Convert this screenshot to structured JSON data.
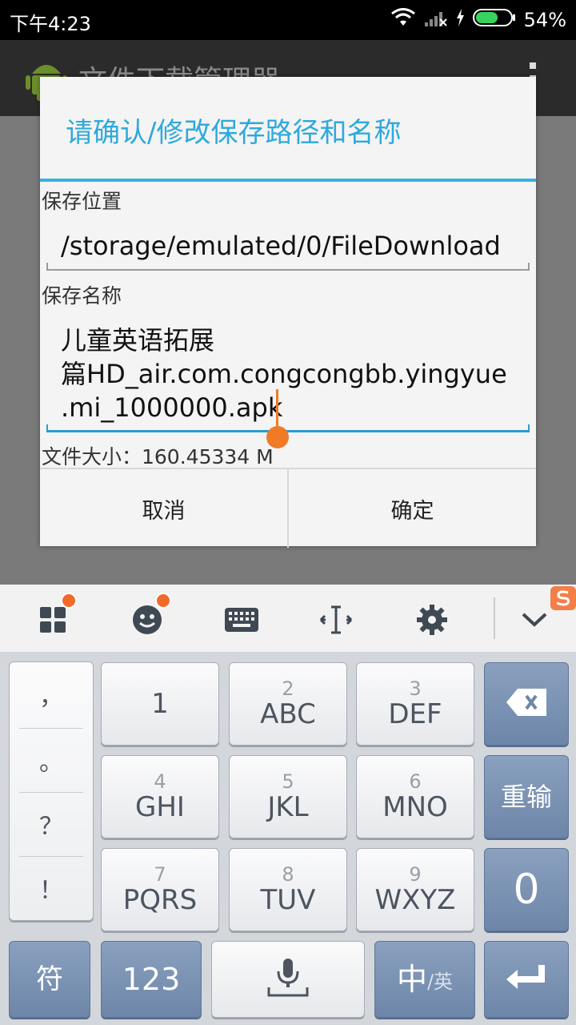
{
  "status_bar": {
    "time": "下午4:23",
    "battery": "54%"
  },
  "app_bar": {
    "title": "文件下载管理器"
  },
  "dialog": {
    "title": "请确认/修改保存路径和名称",
    "save_location_label": "保存位置",
    "save_location_value": "/storage/emulated/0/FileDownload",
    "save_name_label": "保存名称",
    "save_name_line1": "儿童英语拓展",
    "save_name_line2": "篇HD_air.com.congcongbb.yingyue",
    "save_name_line3": ".mi_1000000.apk",
    "file_size": "文件大小：160.45334 M",
    "cancel": "取消",
    "confirm": "确定"
  },
  "ime_toolbar": {
    "icons": [
      "apps-grid-icon",
      "emoji-icon",
      "keyboard-icon",
      "cursor-move-icon",
      "settings-gear-icon",
      "collapse-chevron-icon"
    ]
  },
  "keyboard": {
    "punctuation": [
      "，",
      "。",
      "？",
      "！"
    ],
    "keys": [
      {
        "num": "",
        "letters": "1"
      },
      {
        "num": "2",
        "letters": "ABC"
      },
      {
        "num": "3",
        "letters": "DEF"
      },
      {
        "num": "4",
        "letters": "GHI"
      },
      {
        "num": "5",
        "letters": "JKL"
      },
      {
        "num": "6",
        "letters": "MNO"
      },
      {
        "num": "7",
        "letters": "PQRS"
      },
      {
        "num": "8",
        "letters": "TUV"
      },
      {
        "num": "9",
        "letters": "WXYZ"
      }
    ],
    "reenter": "重输",
    "zero": "0",
    "symbols": "符",
    "numeric": "123",
    "lang_main": "中",
    "lang_sub": "/英"
  },
  "colors": {
    "accent": "#2ea9dc",
    "cursor": "#f07a26",
    "dark_key": "#7a90b1"
  }
}
